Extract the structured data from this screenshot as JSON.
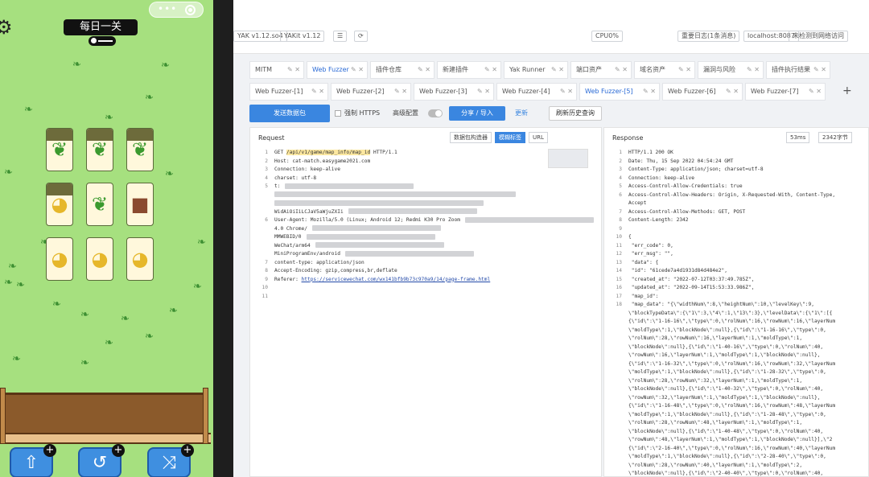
{
  "game": {
    "capsule_dots": "•••",
    "title": "每日一关",
    "tiles": [
      {
        "kind": "grass",
        "capped": true
      },
      {
        "kind": "grass",
        "capped": true
      },
      {
        "kind": "grass",
        "capped": true
      },
      {
        "kind": "bell",
        "capped": true
      },
      {
        "kind": "grass",
        "capped": false
      },
      {
        "kind": "stump",
        "capped": false
      },
      {
        "kind": "bell",
        "capped": false
      },
      {
        "kind": "bell",
        "capped": false
      },
      {
        "kind": "bell",
        "capped": false
      }
    ],
    "tools": [
      {
        "icon": "move-out-icon",
        "glyph": "⇧"
      },
      {
        "icon": "undo-icon",
        "glyph": "↺"
      },
      {
        "icon": "shuffle-icon",
        "glyph": "⤨"
      }
    ],
    "plus": "+"
  },
  "topbar": {
    "chips": [
      "YAK v1.12.so4",
      "YAKit v1.12",
      "☰",
      "⟳",
      "CPU0%",
      "重要日志(1条消息)",
      "localhost:8087",
      "未检测到网络访问"
    ]
  },
  "tabs_row1": [
    {
      "label": "MITM",
      "active": false
    },
    {
      "label": "Web Fuzzer",
      "active": true
    },
    {
      "label": "插件仓库",
      "active": false
    },
    {
      "label": "新建插件",
      "active": false
    },
    {
      "label": "Yak Runner",
      "active": false
    },
    {
      "label": "端口资产",
      "active": false
    },
    {
      "label": "域名资产",
      "active": false
    },
    {
      "label": "漏洞与风险",
      "active": false
    },
    {
      "label": "插件执行结果",
      "active": false
    }
  ],
  "tabs_row2": [
    {
      "label": "Web Fuzzer-[1]",
      "active": false
    },
    {
      "label": "Web Fuzzer-[2]",
      "active": false
    },
    {
      "label": "Web Fuzzer-[3]",
      "active": false
    },
    {
      "label": "Web Fuzzer-[4]",
      "active": false
    },
    {
      "label": "Web Fuzzer-[5]",
      "active": true
    },
    {
      "label": "Web Fuzzer-[6]",
      "active": false
    },
    {
      "label": "Web Fuzzer-[7]",
      "active": false
    }
  ],
  "toolrow": {
    "send": "发送数据包",
    "https": "强制 HTTPS",
    "advanced": "高级配置",
    "share": "分享 / 导入",
    "refresh": "更新",
    "clear": "刷新历史查询"
  },
  "request": {
    "title": "Request",
    "buttons": [
      "数据包构造器",
      "模糊标签",
      "URL"
    ],
    "lines": [
      {
        "n": "1",
        "segments": [
          {
            "t": "GET "
          },
          {
            "t": "/api/v1/game/map_info/map_id",
            "cls": "hl"
          },
          {
            "t": "  HTTP/1.1"
          }
        ]
      },
      {
        "n": "2",
        "segments": [
          {
            "t": "Host: cat-match.easygame2021.com"
          }
        ]
      },
      {
        "n": "3",
        "segments": [
          {
            "t": "Connection: keep-alive"
          }
        ]
      },
      {
        "n": "4",
        "segments": [
          {
            "t": "charset: utf-8"
          }
        ]
      },
      {
        "n": "5",
        "segments": [
          {
            "t": "t:"
          }
        ]
      },
      {
        "n": "",
        "segments": []
      },
      {
        "n": "",
        "segments": []
      },
      {
        "n": "",
        "segments": [
          {
            "t": "WidAiOiIiLCJaV5aWjuZXIi"
          }
        ]
      },
      {
        "n": "6",
        "segments": [
          {
            "t": "User-Agent: Mozilla/5.0 (Linux; Android 12; Redmi K30 Pro Zoom"
          }
        ]
      },
      {
        "n": "",
        "segments": [
          {
            "t": "4.0 Chrome/"
          }
        ]
      },
      {
        "n": "",
        "segments": [
          {
            "t": "MMWEBID/0"
          }
        ]
      },
      {
        "n": "",
        "segments": [
          {
            "t": "WeChat/arm64"
          }
        ]
      },
      {
        "n": "",
        "segments": [
          {
            "t": "MiniProgramEnv/android"
          }
        ]
      },
      {
        "n": "7",
        "segments": [
          {
            "t": "content-type: application/json"
          }
        ]
      },
      {
        "n": "8",
        "segments": [
          {
            "t": "Accept-Encoding: gzip,compress,br,deflate"
          }
        ]
      },
      {
        "n": "9",
        "segments": [
          {
            "t": "Referer: "
          },
          {
            "t": "https://servicewechat.com/wx141bfb9b73c970a9/14/page-frame.html",
            "cls": "ul"
          }
        ]
      },
      {
        "n": "10",
        "segments": []
      },
      {
        "n": "11",
        "segments": []
      }
    ]
  },
  "response": {
    "title": "Response",
    "buttons": [
      "53ms",
      "2342字节"
    ],
    "lines": [
      {
        "n": "1",
        "text": "HTTP/1.1 200 OK"
      },
      {
        "n": "2",
        "text": "Date: Thu, 15 Sep 2022 04:54:24 GMT"
      },
      {
        "n": "3",
        "text": "Content-Type: application/json; charset=utf-8"
      },
      {
        "n": "4",
        "text": "Connection: keep-alive"
      },
      {
        "n": "5",
        "text": "Access-Control-Allow-Credentials: true"
      },
      {
        "n": "6",
        "text": "Access-Control-Allow-Headers: Origin, X-Requested-With, Content-Type,"
      },
      {
        "n": "",
        "text": "Accept"
      },
      {
        "n": "7",
        "text": "Access-Control-Allow-Methods: GET, POST"
      },
      {
        "n": "8",
        "text": "Content-Length: 2342"
      },
      {
        "n": "9",
        "text": ""
      },
      {
        "n": "10",
        "text": "{"
      },
      {
        "n": "11",
        "text": "    \"err_code\": 0,"
      },
      {
        "n": "12",
        "text": "    \"err_msg\": \"\","
      },
      {
        "n": "13",
        "text": "    \"data\": {"
      },
      {
        "n": "14",
        "text": "        \"id\": \"61cede7a4d1931d84d484e2\","
      },
      {
        "n": "15",
        "text": "        \"created_at\": \"2022-07-12T03:37:49.785Z\","
      },
      {
        "n": "16",
        "text": "        \"updated_at\": \"2022-09-14T15:53:33.986Z\","
      },
      {
        "n": "17",
        "text": "        \"map_id\": "
      },
      {
        "n": "18",
        "text": "        \"map_data\": \"{\\\"widthNum\\\":8,\\\"heightNum\\\":10,\\\"levelKey\\\":9,"
      },
      {
        "n": "",
        "text": "\\\"blockTypeData\\\":{\\\"1\\\":3,\\\"4\\\":1,\\\"13\\\":3},\\\"levelData\\\":{\\\"1\\\":[{"
      },
      {
        "n": "",
        "text": "{\\\"id\\\":\\\"1-16-16\\\",\\\"type\\\":0,\\\"rolNum\\\":16,\\\"rowNum\\\":16,\\\"layerNum"
      },
      {
        "n": "",
        "text": "\\\"moldType\\\":1,\\\"blockNode\\\":null},{\\\"id\\\":\\\"1-16-16\\\",\\\"type\\\":0,"
      },
      {
        "n": "",
        "text": "\\\"rolNum\\\":28,\\\"rowNum\\\":16,\\\"layerNum\\\":1,\\\"moldType\\\":1,"
      },
      {
        "n": "",
        "text": "\\\"blockNode\\\":null},{\\\"id\\\":\\\"1-40-16\\\",\\\"type\\\":0,\\\"rolNum\\\":40,"
      },
      {
        "n": "",
        "text": "\\\"rowNum\\\":16,\\\"layerNum\\\":1,\\\"moldType\\\":1,\\\"blockNode\\\":null},"
      },
      {
        "n": "",
        "text": "{\\\"id\\\":\\\"1-16-32\\\",\\\"type\\\":0,\\\"rolNum\\\":16,\\\"rowNum\\\":32,\\\"layerNum"
      },
      {
        "n": "",
        "text": "\\\"moldType\\\":1,\\\"blockNode\\\":null},{\\\"id\\\":\\\"1-28-32\\\",\\\"type\\\":0,"
      },
      {
        "n": "",
        "text": "\\\"rolNum\\\":28,\\\"rowNum\\\":32,\\\"layerNum\\\":1,\\\"moldType\\\":1,"
      },
      {
        "n": "",
        "text": "\\\"blockNode\\\":null},{\\\"id\\\":\\\"1-40-32\\\",\\\"type\\\":0,\\\"rolNum\\\":40,"
      },
      {
        "n": "",
        "text": "\\\"rowNum\\\":32,\\\"layerNum\\\":1,\\\"moldType\\\":1,\\\"blockNode\\\":null},"
      },
      {
        "n": "",
        "text": "{\\\"id\\\":\\\"1-16-48\\\",\\\"type\\\":0,\\\"rolNum\\\":16,\\\"rowNum\\\":48,\\\"layerNum"
      },
      {
        "n": "",
        "text": "\\\"moldType\\\":1,\\\"blockNode\\\":null},{\\\"id\\\":\\\"1-28-48\\\",\\\"type\\\":0,"
      },
      {
        "n": "",
        "text": "\\\"rolNum\\\":28,\\\"rowNum\\\":48,\\\"layerNum\\\":1,\\\"moldType\\\":1,"
      },
      {
        "n": "",
        "text": "\\\"blockNode\\\":null},{\\\"id\\\":\\\"1-40-48\\\",\\\"type\\\":0,\\\"rolNum\\\":40,"
      },
      {
        "n": "",
        "text": "\\\"rowNum\\\":48,\\\"layerNum\\\":1,\\\"moldType\\\":1,\\\"blockNode\\\":null}],\\\"2"
      },
      {
        "n": "",
        "text": "{\\\"id\\\":\\\"2-16-40\\\",\\\"type\\\":0,\\\"rolNum\\\":16,\\\"rowNum\\\":40,\\\"layerNum"
      },
      {
        "n": "",
        "text": "\\\"moldType\\\":1,\\\"blockNode\\\":null},{\\\"id\\\":\\\"2-28-40\\\",\\\"type\\\":0,"
      },
      {
        "n": "",
        "text": "\\\"rolNum\\\":28,\\\"rowNum\\\":40,\\\"layerNum\\\":1,\\\"moldType\\\":2,"
      },
      {
        "n": "",
        "text": "\\\"blockNode\\\":null},{\\\"id\\\":\\\"2-40-40\\\",\\\"type\\\":0,\\\"rolNum\\\":40,"
      }
    ]
  }
}
